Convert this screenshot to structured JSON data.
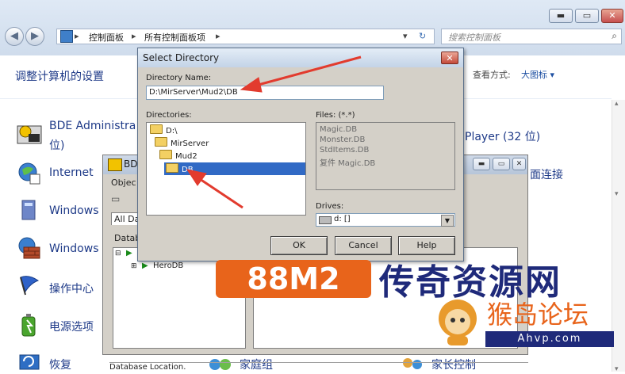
{
  "explorer": {
    "breadcrumb": [
      "控制面板",
      "所有控制面板项"
    ],
    "search_placeholder": "搜索控制面板",
    "heading": "调整计算机的设置",
    "view_by_label": "查看方式:",
    "view_by_value": "大图标 ▾",
    "window_buttons": {
      "minimize": "▬",
      "maximize": "▭",
      "close": "✕"
    },
    "items_left": [
      {
        "label_line1": "BDE Administra",
        "label_line2": "位)",
        "icon": "bde-admin-icon"
      },
      {
        "label_line1": "Internet",
        "icon": "internet-options-icon"
      },
      {
        "label_line1": "Windows",
        "icon": "windows-anytime-upgrade-icon"
      },
      {
        "label_line1": "Windows",
        "icon": "windows-firewall-icon"
      },
      {
        "label_line1": "操作中心",
        "icon": "action-center-flag-icon"
      },
      {
        "label_line1": "电源选项",
        "icon": "power-options-icon"
      },
      {
        "label_line1": "恢复",
        "icon": "recovery-icon"
      }
    ],
    "items_right": [
      {
        "label": "Player (32 位)"
      },
      {
        "label": "面连接"
      }
    ],
    "items_bottom": [
      "家庭组",
      "家长控制"
    ]
  },
  "bde_window": {
    "title": "BD",
    "menu_fragment": "Objec",
    "tab_label": "All Datab",
    "panel_label": "Databa",
    "tree_items": [
      "HeroDB"
    ],
    "status": "Database Location."
  },
  "select_directory": {
    "title": "Select Directory",
    "close_label": "✕",
    "directory_name_label": "Directory Name:",
    "directory_name_value": "D:\\MirServer\\Mud2\\DB",
    "directories_label": "Directories:",
    "directories": [
      "D:\\",
      "MirServer",
      "Mud2",
      "DB"
    ],
    "selected_directory": "DB",
    "files_label": "Files: (*.*)",
    "files": [
      "Magic.DB",
      "Monster.DB",
      "StdItems.DB",
      "复件 Magic.DB"
    ],
    "drives_label": "Drives:",
    "drive_value": "d: []",
    "buttons": {
      "ok": "OK",
      "cancel": "Cancel",
      "help": "Help"
    }
  },
  "watermark": {
    "brand_left": "88M2",
    "brand_right": "传奇资源网",
    "forum": "猴岛论坛",
    "url": "Ahvp.com"
  },
  "colors": {
    "annotation_arrow": "#e23b2e",
    "selection": "#316ac5",
    "watermark_orange": "#e8641b",
    "watermark_navy": "#1f2a7a"
  }
}
